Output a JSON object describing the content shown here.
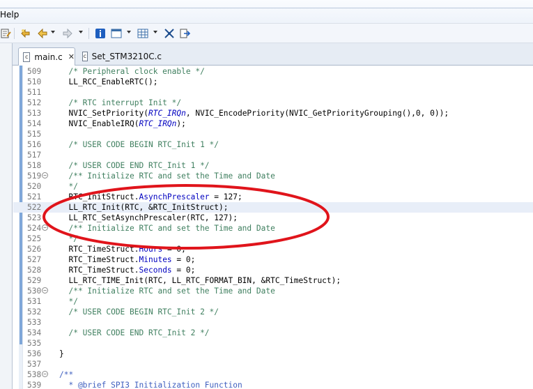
{
  "menu": {
    "items": [
      "Help"
    ]
  },
  "toolbar": {
    "icons": [
      "edit-doc-icon",
      "back-history-icon",
      "back-arrow-icon",
      "forward-arrow-icon",
      "info-icon",
      "window-icon",
      "table-icon",
      "fullscreen-icon",
      "exit-icon"
    ]
  },
  "tabs": [
    {
      "label": "main.c",
      "icon": "c",
      "close": "✕",
      "active": true
    },
    {
      "label": "Set_STM3210C.c",
      "icon": "c",
      "active": false
    }
  ],
  "colors": {
    "highlight_oval": "#e0141b",
    "current_line": "#e8eef8",
    "comment": "#3f7f5f",
    "field": "#0000c0"
  },
  "editor": {
    "lines": [
      {
        "n": "509",
        "fold": "",
        "segs": [
          [
            "cm",
            "  /* Peripheral clock enable */"
          ]
        ]
      },
      {
        "n": "510",
        "fold": "",
        "segs": [
          [
            "",
            "  LL_RCC_EnableRTC();"
          ]
        ]
      },
      {
        "n": "511",
        "fold": "",
        "segs": []
      },
      {
        "n": "512",
        "fold": "",
        "segs": [
          [
            "cm",
            "  /* RTC interrupt Init */"
          ]
        ]
      },
      {
        "n": "513",
        "fold": "",
        "segs": [
          [
            "",
            "  NVIC_SetPriority("
          ],
          [
            "it",
            "RTC_IRQn"
          ],
          [
            "",
            ", NVIC_EncodePriority(NVIC_GetPriorityGrouping(),0, 0));"
          ]
        ]
      },
      {
        "n": "514",
        "fold": "",
        "segs": [
          [
            "",
            "  NVIC_EnableIRQ("
          ],
          [
            "it",
            "RTC_IRQn"
          ],
          [
            "",
            ");"
          ]
        ]
      },
      {
        "n": "515",
        "fold": "",
        "segs": []
      },
      {
        "n": "516",
        "fold": "",
        "segs": [
          [
            "cm",
            "  /* USER CODE BEGIN RTC_Init 1 */"
          ]
        ]
      },
      {
        "n": "517",
        "fold": "",
        "segs": []
      },
      {
        "n": "518",
        "fold": "",
        "segs": [
          [
            "cm",
            "  /* USER CODE END RTC_Init 1 */"
          ]
        ]
      },
      {
        "n": "519",
        "fold": "⊖",
        "segs": [
          [
            "cm",
            "  /** Initialize RTC and set the Time and Date"
          ]
        ]
      },
      {
        "n": "520",
        "fold": "",
        "segs": [
          [
            "cm",
            "  */"
          ]
        ]
      },
      {
        "n": "521",
        "fold": "",
        "segs": [
          [
            "",
            "  RTC_InitStruct."
          ],
          [
            "fld",
            "AsynchPrescaler"
          ],
          [
            "",
            " = 127;"
          ]
        ]
      },
      {
        "n": "522",
        "fold": "",
        "hl": true,
        "segs": [
          [
            "",
            "  LL_RTC_Init(RTC, &RTC_InitStruct);"
          ]
        ]
      },
      {
        "n": "523",
        "fold": "",
        "segs": [
          [
            "",
            "  LL_RTC_SetAsynchPrescaler(RTC, 127);"
          ]
        ]
      },
      {
        "n": "524",
        "fold": "⊖",
        "segs": [
          [
            "cm",
            "  /** Initialize RTC and set the Time and Date"
          ]
        ]
      },
      {
        "n": "525",
        "fold": "",
        "segs": [
          [
            "cm",
            "  */"
          ]
        ]
      },
      {
        "n": "526",
        "fold": "",
        "segs": [
          [
            "",
            "  RTC_TimeStruct."
          ],
          [
            "fld",
            "Hours"
          ],
          [
            "",
            " = 0;"
          ]
        ]
      },
      {
        "n": "527",
        "fold": "",
        "segs": [
          [
            "",
            "  RTC_TimeStruct."
          ],
          [
            "fld",
            "Minutes"
          ],
          [
            "",
            " = 0;"
          ]
        ]
      },
      {
        "n": "528",
        "fold": "",
        "segs": [
          [
            "",
            "  RTC_TimeStruct."
          ],
          [
            "fld",
            "Seconds"
          ],
          [
            "",
            " = 0;"
          ]
        ]
      },
      {
        "n": "529",
        "fold": "",
        "segs": [
          [
            "",
            "  LL_RTC_TIME_Init(RTC, LL_RTC_FORMAT_BIN, &RTC_TimeStruct);"
          ]
        ]
      },
      {
        "n": "530",
        "fold": "⊖",
        "segs": [
          [
            "cm",
            "  /** Initialize RTC and set the Time and Date"
          ]
        ]
      },
      {
        "n": "531",
        "fold": "",
        "segs": [
          [
            "cm",
            "  */"
          ]
        ]
      },
      {
        "n": "532",
        "fold": "",
        "segs": [
          [
            "cm",
            "  /* USER CODE BEGIN RTC_Init 2 */"
          ]
        ]
      },
      {
        "n": "533",
        "fold": "",
        "segs": []
      },
      {
        "n": "534",
        "fold": "",
        "segs": [
          [
            "cm",
            "  /* USER CODE END RTC_Init 2 */"
          ]
        ]
      },
      {
        "n": "535",
        "fold": "",
        "segs": []
      },
      {
        "n": "536",
        "fold": "",
        "segs": [
          [
            "",
            "}"
          ]
        ]
      },
      {
        "n": "537",
        "fold": "",
        "segs": []
      },
      {
        "n": "538",
        "fold": "⊖",
        "segs": [
          [
            "doc",
            "/**"
          ]
        ]
      },
      {
        "n": "539",
        "fold": "",
        "segs": [
          [
            "doc",
            "  * @brief SPI3 Initialization Function"
          ]
        ]
      }
    ]
  }
}
